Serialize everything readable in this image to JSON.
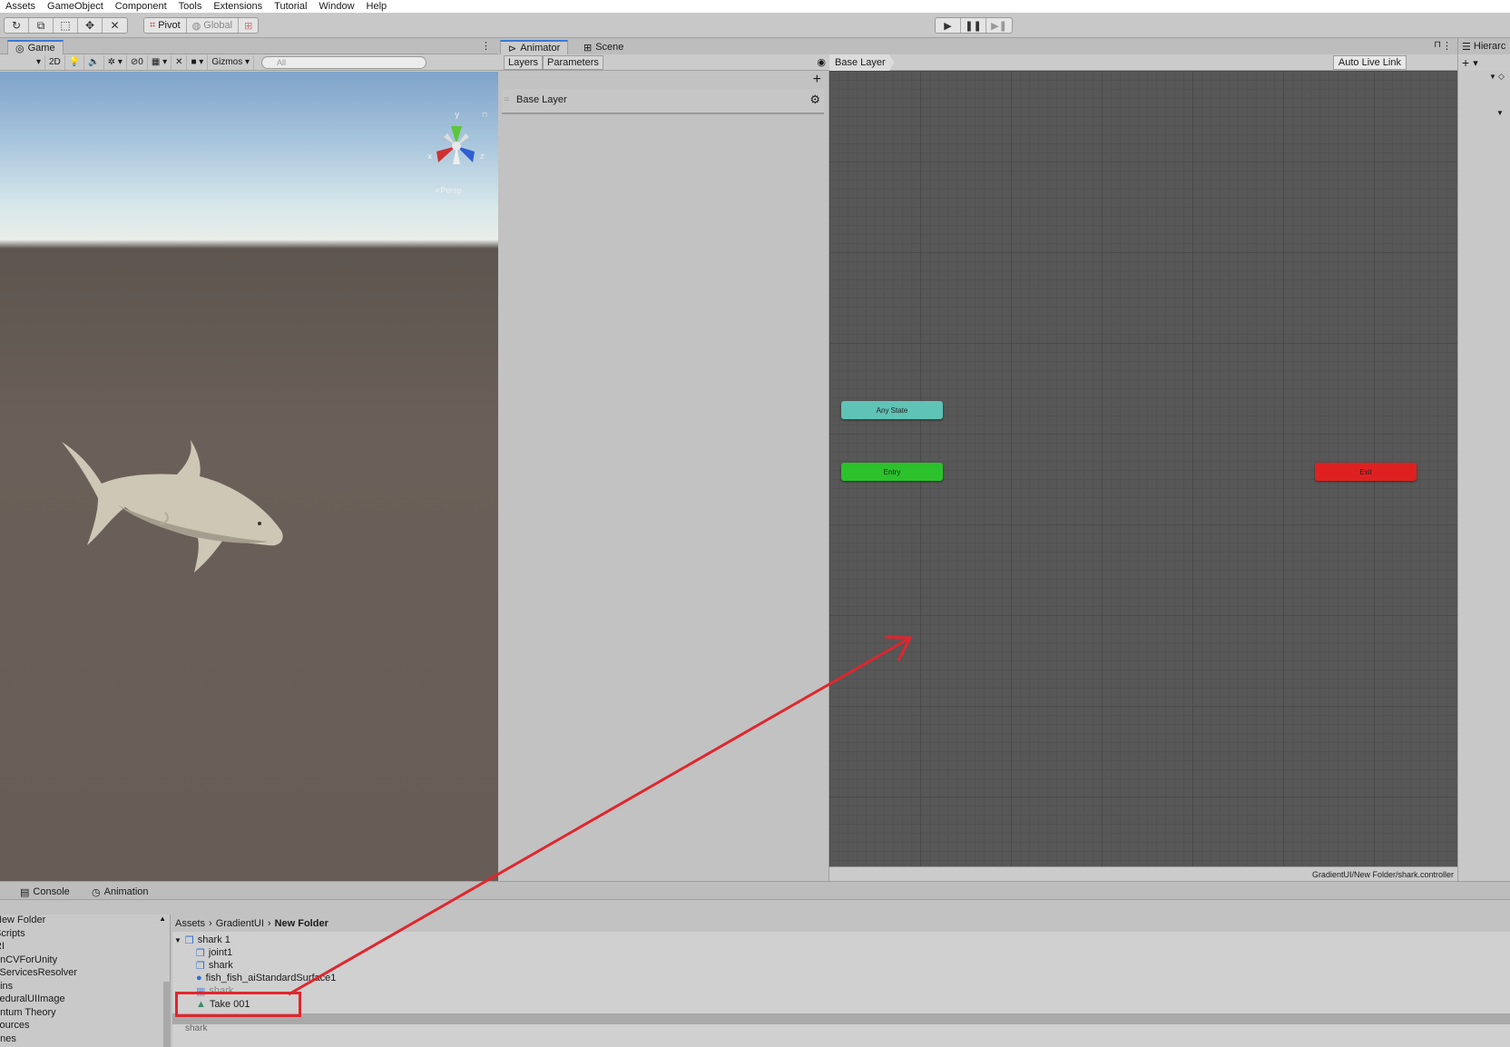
{
  "menu": [
    "Assets",
    "GameObject",
    "Component",
    "Tools",
    "Extensions",
    "Tutorial",
    "Window",
    "Help"
  ],
  "toolbar": {
    "pivot": "Pivot",
    "global": "Global"
  },
  "game": {
    "tab": "Game",
    "mode_2d": "2D",
    "hidden_count": "0",
    "gizmos": "Gizmos",
    "search_placeholder": "All",
    "persp": "<Persp",
    "axis_y": "y",
    "axis_x": "x",
    "axis_z": "z"
  },
  "animator": {
    "tab": "Animator",
    "scene_tab": "Scene",
    "layers_tab": "Layers",
    "parameters_tab": "Parameters",
    "layer_name": "Base Layer",
    "breadcrumb": "Base Layer",
    "auto_live_link": "Auto Live Link",
    "states": {
      "any_state": "Any State",
      "entry": "Entry",
      "exit": "Exit"
    },
    "footer_path": "GradientUI/New Folder/shark.controller"
  },
  "hierarchy": {
    "tab": "Hierarc"
  },
  "bottom": {
    "console_tab": "Console",
    "animation_tab": "Animation",
    "folders": [
      "New Folder",
      "Scripts",
      "RI",
      "enCVForUnity",
      "yServicesResolver",
      "gins",
      "ceduralUIImage",
      "antum Theory",
      "sources",
      "enes"
    ],
    "breadcrumb": [
      "Assets",
      "GradientUI",
      "New Folder"
    ],
    "assets": {
      "parent": "shark 1",
      "joint": "joint1",
      "shark": "shark",
      "material": "fish_fish_aiStandardSurface1",
      "mesh": "shark",
      "clip": "Take 001",
      "next": "shark"
    }
  },
  "colors": {
    "any_state": "#5fc3b6",
    "entry": "#2bc22b",
    "exit": "#e02020",
    "annotation": "#e0262d",
    "tab_accent": "#3a79d6"
  }
}
